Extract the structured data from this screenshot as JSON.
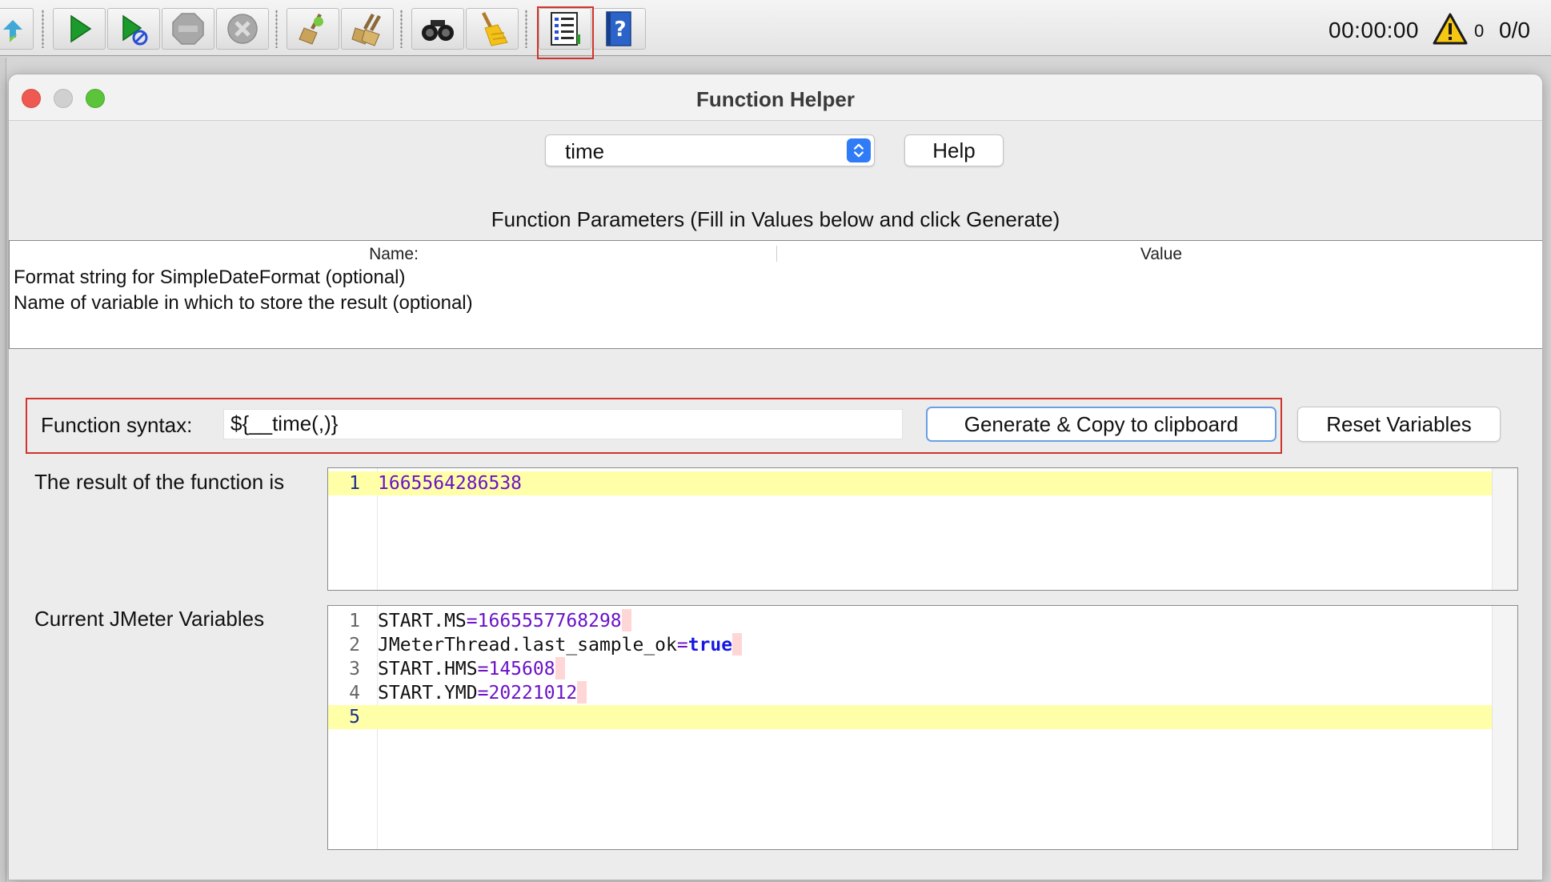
{
  "toolbar": {
    "timer": "00:00:00",
    "warning_count": "0",
    "threads": "0/0",
    "icons": [
      "expand-icon",
      "start-icon",
      "start-no-pauses-icon",
      "stop-icon",
      "shutdown-icon",
      "clear-icon",
      "clear-all-icon",
      "search-icon",
      "reset-search-icon",
      "function-helper-icon",
      "help-icon",
      "warning-icon"
    ],
    "highlight_color": "#d0342c"
  },
  "window": {
    "title": "Function Helper"
  },
  "function_select": {
    "value": "time"
  },
  "help_button": "Help",
  "parameters": {
    "label": "Function Parameters (Fill in Values below and click Generate)",
    "columns": [
      "Name:",
      "Value"
    ],
    "rows": [
      {
        "name": "Format string for SimpleDateFormat (optional)",
        "value": ""
      },
      {
        "name": "Name of variable in which to store the result (optional)",
        "value": ""
      }
    ]
  },
  "syntax": {
    "label": "Function syntax:",
    "value": "${__time(,)}",
    "generate_button": "Generate & Copy to clipboard",
    "reset_button": "Reset Variables"
  },
  "result": {
    "label": "The result of the function is",
    "lines": [
      {
        "number": "1",
        "value": "1665564286538"
      }
    ]
  },
  "variables": {
    "label": "Current JMeter Variables",
    "lines": [
      {
        "number": "1",
        "key": "START.MS",
        "eq": "=",
        "value": "1665557768298"
      },
      {
        "number": "2",
        "key": "JMeterThread.last_sample_ok",
        "eq": "=",
        "value": "true"
      },
      {
        "number": "3",
        "key": "START.HMS",
        "eq": "=",
        "value": "145608"
      },
      {
        "number": "4",
        "key": "START.YMD",
        "eq": "=",
        "value": "20221012"
      },
      {
        "number": "5",
        "key": "",
        "eq": "",
        "value": ""
      }
    ]
  },
  "colors": {
    "current_line": "#ffffa8",
    "number_literal": "#6b13c8",
    "keyword": "#1518e0",
    "accent": "#2f7cf6"
  }
}
